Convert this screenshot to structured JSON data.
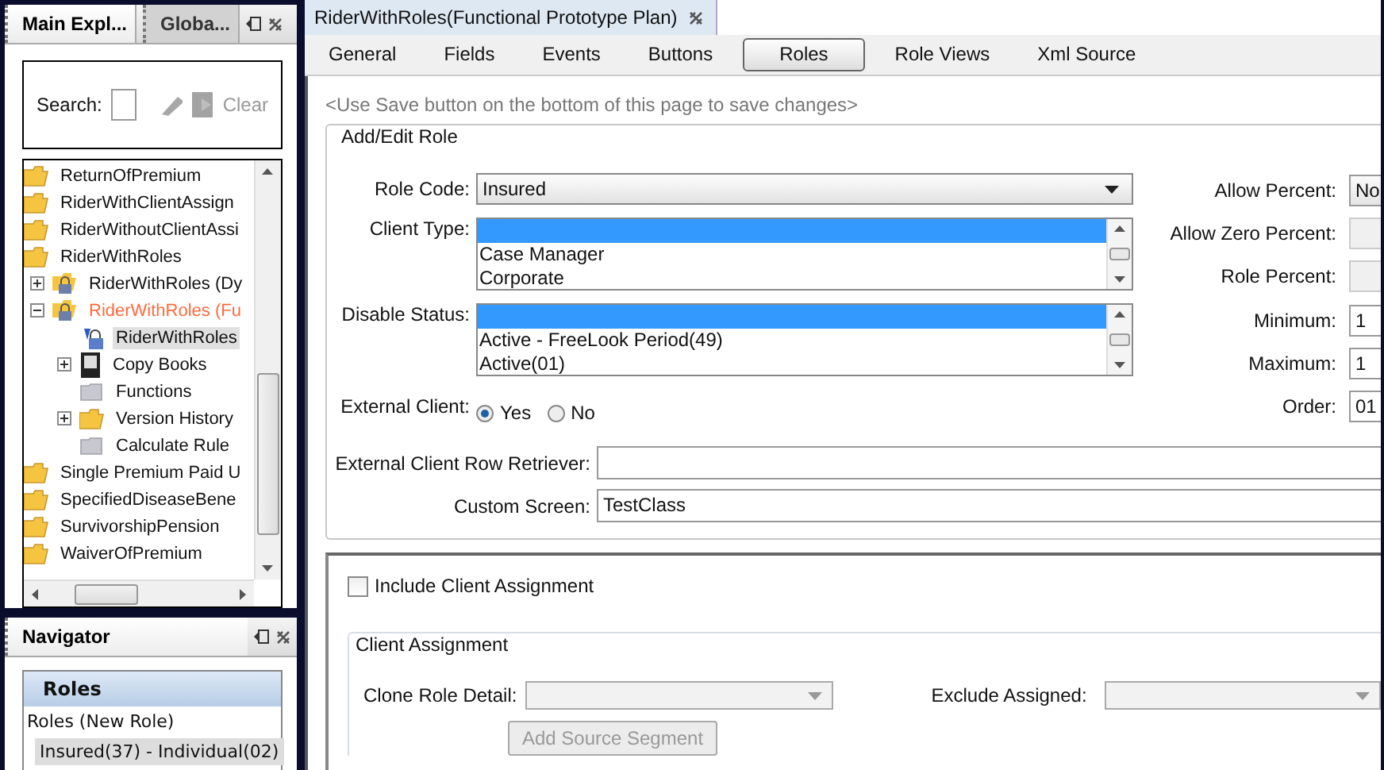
{
  "left_panel": {
    "tabs": [
      {
        "label": "Main Expl...",
        "selected": true
      },
      {
        "label": "Globa...",
        "selected": false
      }
    ],
    "search": {
      "label": "Search:",
      "clear": "Clear"
    },
    "tree": [
      {
        "label": "ReturnOfPremium",
        "kind": "folder",
        "selected": false,
        "open": false
      },
      {
        "label": "RiderWithClientAssign",
        "kind": "folder",
        "selected": false,
        "open": false
      },
      {
        "label": "RiderWithoutClientAssi",
        "kind": "folder",
        "selected": false,
        "open": false
      },
      {
        "label": "RiderWithRoles",
        "kind": "folder",
        "selected": false,
        "open": false,
        "children": [
          {
            "label": "RiderWithRoles (Dy",
            "kind": "locked-folder",
            "selected": false,
            "open": false,
            "expanded": false
          },
          {
            "label": "RiderWithRoles (Fu",
            "kind": "locked-folder",
            "selected": false,
            "open": true,
            "expanded": true,
            "children": [
              {
                "label": "RiderWithRoles",
                "kind": "rule",
                "selected": true,
                "open": false
              },
              {
                "label": "Copy Books",
                "kind": "book",
                "selected": false,
                "open": false,
                "expanded": false
              },
              {
                "label": "Functions",
                "kind": "grey-folder",
                "selected": false,
                "open": false
              },
              {
                "label": "Version History",
                "kind": "folder",
                "selected": false,
                "open": false,
                "expanded": false
              },
              {
                "label": "Calculate Rule",
                "kind": "grey-folder",
                "selected": false,
                "open": false
              }
            ]
          }
        ]
      },
      {
        "label": "Single Premium Paid U",
        "kind": "folder",
        "selected": false,
        "open": false
      },
      {
        "label": "SpecifiedDiseaseBene",
        "kind": "folder",
        "selected": false,
        "open": false
      },
      {
        "label": "SurvivorshipPension",
        "kind": "folder",
        "selected": false,
        "open": false
      },
      {
        "label": "WaiverOfPremium",
        "kind": "folder",
        "selected": false,
        "open": false
      }
    ]
  },
  "navigator": {
    "title": "Navigator",
    "header": "Roles",
    "items": [
      {
        "label": "Roles (New Role)",
        "kind": "text",
        "selected": false
      },
      {
        "label": "Insured(37) - Individual(02)",
        "kind": "role",
        "selected": true
      }
    ]
  },
  "editor": {
    "title": "RiderWithRoles(Functional Prototype Plan)",
    "tabs": [
      {
        "label": "General",
        "selected": false
      },
      {
        "label": "Fields",
        "selected": false
      },
      {
        "label": "Events",
        "selected": false
      },
      {
        "label": "Buttons",
        "selected": false
      },
      {
        "label": "Roles",
        "selected": true
      },
      {
        "label": "Role Views",
        "selected": false
      },
      {
        "label": "Xml Source",
        "selected": false
      }
    ],
    "hint": "<Use Save button on the bottom of this page to save changes>",
    "role_section": {
      "legend": "Add/Edit Role",
      "role_code": {
        "label": "Role Code:",
        "value": "Insured"
      },
      "client_type": {
        "label": "Client Type:",
        "blank_selected": true,
        "options": [
          "Case Manager",
          "Corporate"
        ]
      },
      "disable_status": {
        "label": "Disable Status:",
        "blank_selected": true,
        "options": [
          "Active - FreeLook Period(49)",
          "Active(01)"
        ]
      },
      "external_client": {
        "label": "External Client:",
        "options": [
          {
            "label": "Yes",
            "selected": true
          },
          {
            "label": "No",
            "selected": false
          }
        ]
      },
      "retriever": {
        "label": "External Client Row Retriever:"
      },
      "custom_screen": {
        "label": "Custom Screen:",
        "value": "TestClass"
      },
      "right_fields": [
        {
          "label": "Allow Percent:",
          "kind": "combo",
          "value": "No"
        },
        {
          "label": "Allow Zero Percent:",
          "kind": "disabled"
        },
        {
          "label": "Role Percent:",
          "kind": "disabled"
        },
        {
          "label": "Minimum:",
          "kind": "text",
          "value": "1"
        },
        {
          "label": "Maximum:",
          "kind": "text",
          "value": "1"
        },
        {
          "label": "Order:",
          "kind": "text",
          "value": "01"
        }
      ]
    },
    "assignment": {
      "checkbox": {
        "label": "Include Client Assignment",
        "checked": false
      },
      "legend": "Client Assignment",
      "clone": {
        "label": "Clone Role Detail:"
      },
      "exclude": {
        "label": "Exclude Assigned:"
      },
      "button": {
        "label": "Add Source Segment",
        "disabled": true
      }
    }
  }
}
